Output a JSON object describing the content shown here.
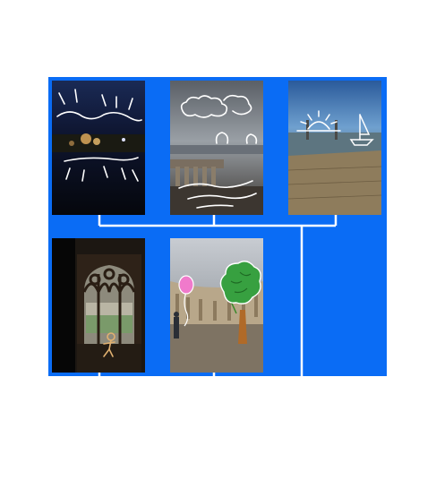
{
  "colors": {
    "background": "#ffffff",
    "panel": "#0a6cf5",
    "connector": "#ffffff"
  },
  "thumbnails": [
    {
      "id": "night-town",
      "icon": "night-town-photo-with-scribbles"
    },
    {
      "id": "cloudy-terrace",
      "icon": "terrace-photo-with-cloud-doodles"
    },
    {
      "id": "seaside",
      "icon": "sea-photo-with-sun-and-boat-doodles"
    },
    {
      "id": "cloister-window",
      "icon": "cloister-photo-with-stick-figure"
    },
    {
      "id": "courtyard",
      "icon": "courtyard-photo-with-tree-and-balloon"
    }
  ]
}
